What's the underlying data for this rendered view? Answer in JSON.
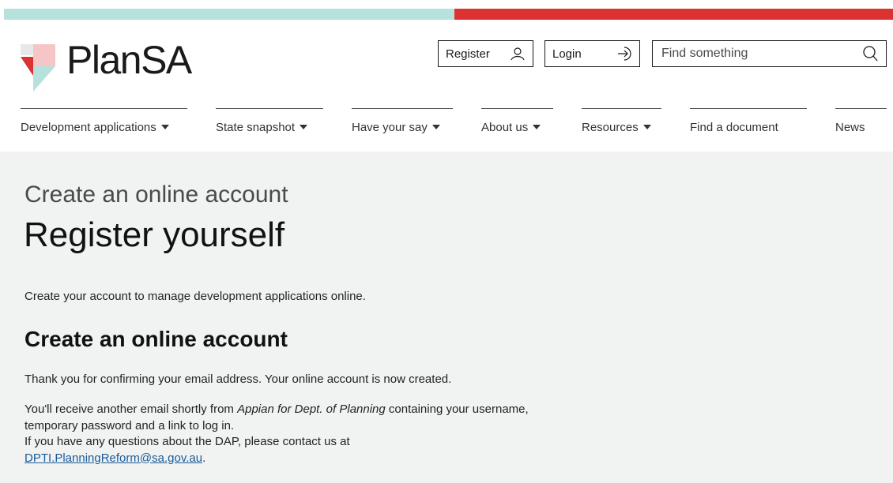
{
  "brand": {
    "name": "PlanSA",
    "colors": {
      "teal": "#b7e1dd",
      "red": "#dd3232",
      "pink": "#f6c6c6"
    }
  },
  "header": {
    "register_label": "Register",
    "login_label": "Login",
    "search_placeholder": "Find something"
  },
  "nav": {
    "items": [
      {
        "label": "Development applications",
        "dropdown": true
      },
      {
        "label": "State snapshot",
        "dropdown": true
      },
      {
        "label": "Have your say",
        "dropdown": true
      },
      {
        "label": "About us",
        "dropdown": true
      },
      {
        "label": "Resources",
        "dropdown": true
      },
      {
        "label": "Find a document",
        "dropdown": false
      },
      {
        "label": "News",
        "dropdown": false
      }
    ]
  },
  "page": {
    "kicker": "Create an online account",
    "title": "Register yourself",
    "intro": "Create your account to manage development applications online.",
    "section_heading": "Create an online account",
    "confirmation": "Thank you for confirming your email address. Your online account is now created.",
    "info_part1": "You'll receive another email shortly from ",
    "info_sender": "Appian for Dept. of Planning",
    "info_part2": " containing your username, temporary password and a link to log in.",
    "questions_text": "If you have any questions about the DAP, please contact us at",
    "contact_email": "DPTI.PlanningReform@sa.gov.au",
    "trailing": "."
  }
}
